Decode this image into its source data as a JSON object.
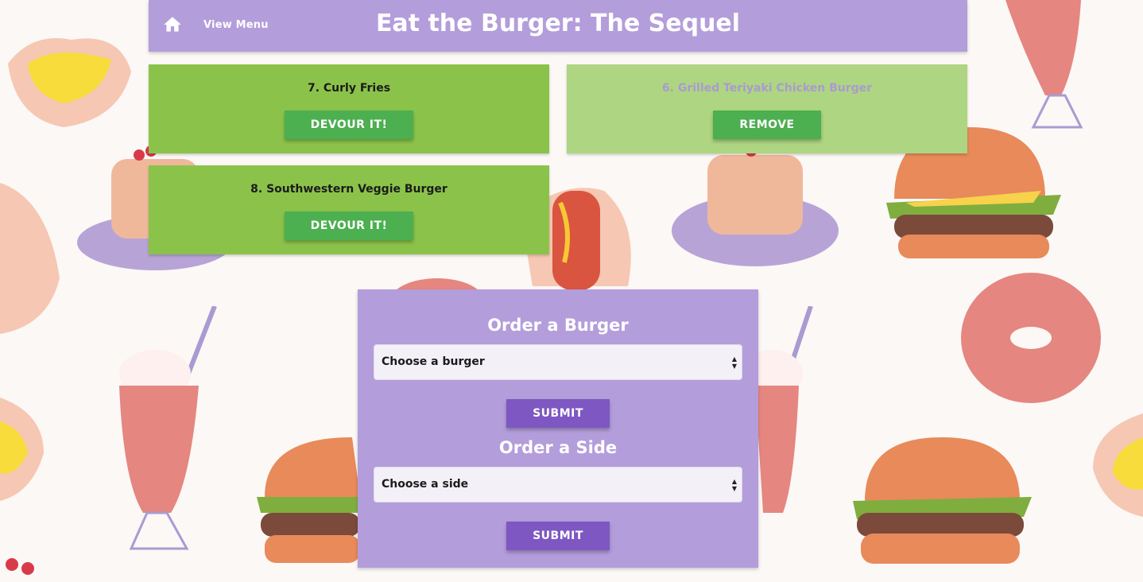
{
  "nav": {
    "home_icon": "home-icon",
    "menu_link": "View Menu",
    "brand": "Eat the Burger: The Sequel"
  },
  "uneaten": [
    {
      "title": "7. Curly Fries",
      "button": "DEVOUR IT!"
    },
    {
      "title": "8. Southwestern Veggie Burger",
      "button": "DEVOUR IT!"
    }
  ],
  "eaten": [
    {
      "title": "6. Grilled Teriyaki Chicken Burger",
      "button": "REMOVE"
    }
  ],
  "order_burger": {
    "heading": "Order a Burger",
    "select_value": "Choose a burger",
    "submit": "SUBMIT"
  },
  "order_side": {
    "heading": "Order a Side",
    "select_value": "Choose a side",
    "submit": "SUBMIT"
  },
  "colors": {
    "nav": "#b39ddb",
    "card_active": "#8bc34a",
    "card_eaten": "#aed581",
    "button_green": "#4caf50",
    "button_purple": "#7e57c2"
  }
}
